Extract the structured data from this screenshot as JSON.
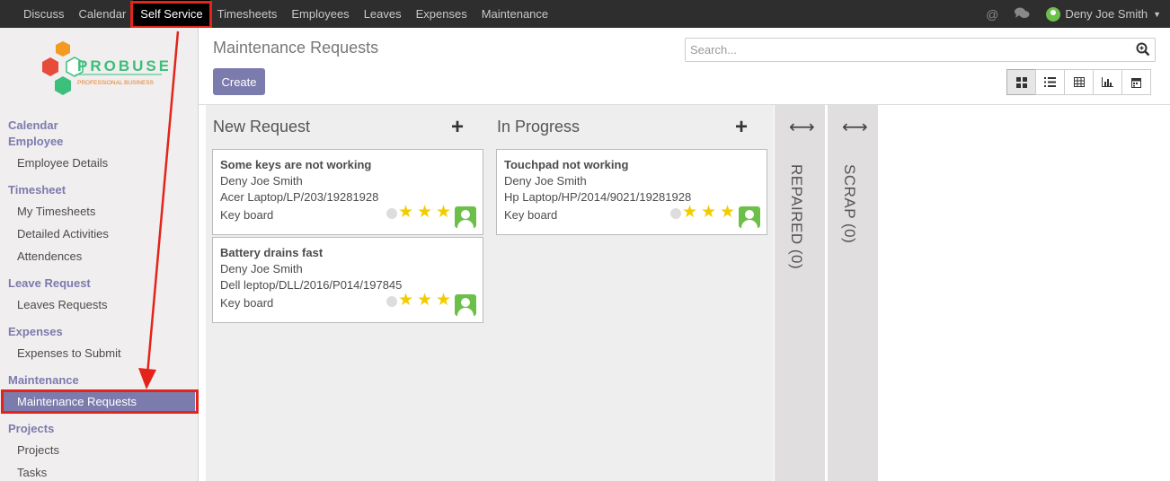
{
  "topnav": {
    "items": [
      "Discuss",
      "Calendar",
      "Self Service",
      "Timesheets",
      "Employees",
      "Leaves",
      "Expenses",
      "Maintenance"
    ],
    "active": "Self Service",
    "user": "Deny Joe Smith"
  },
  "logo": {
    "name": "PROBUSE",
    "tagline": "PROFESSIONAL BUSINESS"
  },
  "sidebar": {
    "sections": [
      {
        "title": "Calendar"
      },
      {
        "title": "Employee",
        "items": [
          "Employee Details"
        ]
      },
      {
        "title": "Timesheet",
        "items": [
          "My Timesheets",
          "Detailed Activities",
          "Attendences"
        ]
      },
      {
        "title": "Leave Request",
        "items": [
          "Leaves Requests"
        ]
      },
      {
        "title": "Expenses",
        "items": [
          "Expenses to Submit"
        ]
      },
      {
        "title": "Maintenance",
        "items": [
          "Maintenance Requests"
        ]
      },
      {
        "title": "Projects",
        "items": [
          "Projects",
          "Tasks"
        ]
      }
    ],
    "active_item": "Maintenance Requests"
  },
  "page": {
    "title": "Maintenance Requests",
    "create_label": "Create",
    "search_placeholder": "Search..."
  },
  "kanban": {
    "columns": [
      {
        "title": "New Request",
        "cards": [
          {
            "title": "Some keys are not working",
            "employee": "Deny Joe Smith",
            "equipment": "Acer Laptop/LP/203/19281928",
            "category": "Key board",
            "stars": 3
          },
          {
            "title": "Battery drains fast",
            "employee": "Deny Joe Smith",
            "equipment": "Dell leptop/DLL/2016/P014/197845",
            "category": "Key board",
            "stars": 3
          }
        ]
      },
      {
        "title": "In Progress",
        "cards": [
          {
            "title": "Touchpad not working",
            "employee": "Deny Joe Smith",
            "equipment": "Hp Laptop/HP/2014/9021/19281928",
            "category": "Key board",
            "stars": 3
          }
        ]
      }
    ],
    "folded": [
      "REPAIRED (0)",
      "SCRAP (0)"
    ]
  },
  "colors": {
    "accent": "#7c7bad",
    "star": "#f3cc00",
    "annotation": "#e3241b"
  }
}
